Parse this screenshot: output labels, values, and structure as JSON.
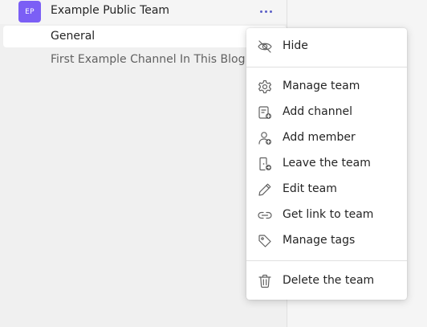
{
  "team": {
    "avatar_initials": "EP",
    "avatar_color": "#7b5ff5",
    "name": "Example Public Team",
    "more_icon": "more-horizontal-icon",
    "accent_color": "#5b5fc7"
  },
  "channels": [
    {
      "label": "General",
      "selected": true
    },
    {
      "label": "First Example Channel In This Blog Post",
      "selected": false
    }
  ],
  "context_menu": {
    "items": [
      {
        "label": "Hide",
        "icon": "eye-off-icon"
      },
      {
        "label": "Manage team",
        "icon": "gear-icon"
      },
      {
        "label": "Add channel",
        "icon": "add-channel-icon"
      },
      {
        "label": "Add member",
        "icon": "add-person-icon"
      },
      {
        "label": "Leave the team",
        "icon": "leave-door-icon"
      },
      {
        "label": "Edit team",
        "icon": "pencil-icon"
      },
      {
        "label": "Get link to team",
        "icon": "link-icon"
      },
      {
        "label": "Manage tags",
        "icon": "tag-icon"
      },
      {
        "label": "Delete the team",
        "icon": "trash-icon"
      }
    ]
  }
}
